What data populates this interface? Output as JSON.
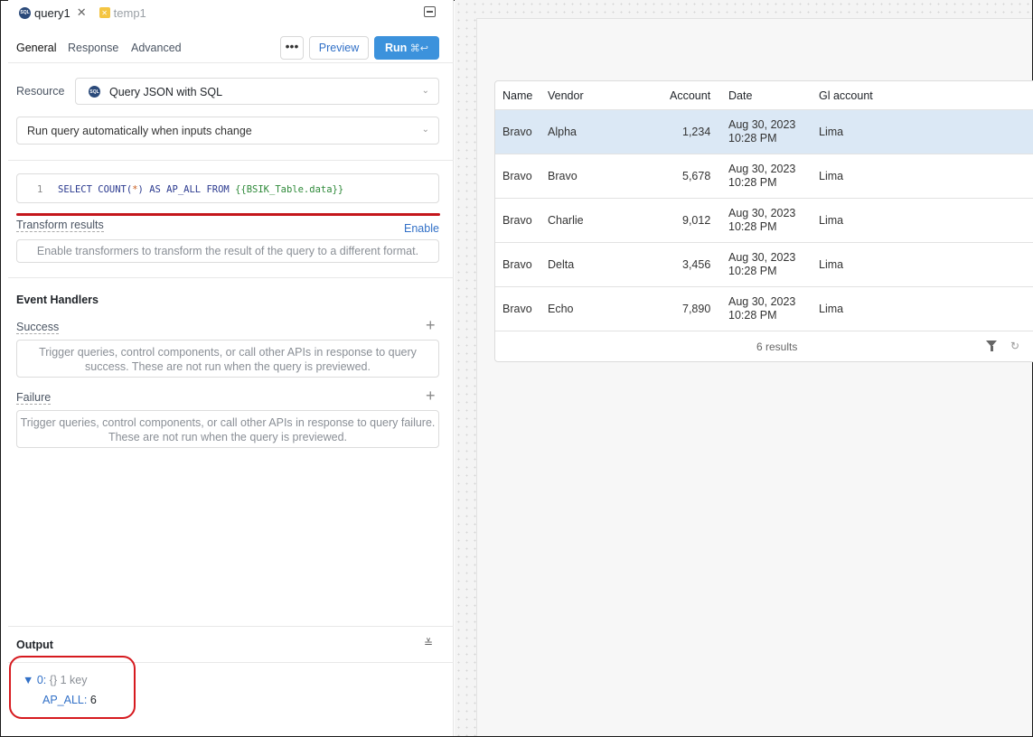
{
  "tabs": [
    {
      "label": "query1",
      "icon": "sql-icon"
    },
    {
      "label": "temp1",
      "icon": "js-icon"
    }
  ],
  "subnav": {
    "general": "General",
    "response": "Response",
    "advanced": "Advanced",
    "more": "•••",
    "preview": "Preview",
    "run": "Run",
    "run_shortcut": "⌘↩"
  },
  "resource": {
    "label": "Resource",
    "value": "Query JSON with SQL",
    "badge": "SQL"
  },
  "run_mode": "Run query automatically when inputs change",
  "editor": {
    "line": "1",
    "kw_select": "SELECT",
    "count_fn": "COUNT(",
    "star": "*",
    "count_close": ")",
    "kw_as": "AS",
    "alias": "AP_ALL",
    "kw_from": "FROM",
    "template": "{{BSIK_Table.data}}"
  },
  "transform": {
    "label": "Transform results",
    "enable": "Enable",
    "placeholder": "Enable transformers to transform the result of the query to a different format."
  },
  "events": {
    "title": "Event Handlers",
    "success_label": "Success",
    "success_help": "Trigger queries, control components, or call other APIs in response to query success. These are not run when the query is previewed.",
    "failure_label": "Failure",
    "failure_help": "Trigger queries, control components, or call other APIs in response to query failure. These are not run when the query is previewed."
  },
  "output": {
    "title": "Output",
    "index": "0:",
    "type": "{}",
    "keys": "1 key",
    "key": "AP_ALL:",
    "value": "6"
  },
  "table": {
    "columns": [
      "Name",
      "Vendor",
      "Account",
      "Date",
      "Gl account"
    ],
    "rows": [
      {
        "name": "Bravo",
        "vendor": "Alpha",
        "account": "1,234",
        "date1": "Aug 30, 2023",
        "date2": "10:28 PM",
        "gl": "Lima"
      },
      {
        "name": "Bravo",
        "vendor": "Bravo",
        "account": "5,678",
        "date1": "Aug 30, 2023",
        "date2": "10:28 PM",
        "gl": "Lima"
      },
      {
        "name": "Bravo",
        "vendor": "Charlie",
        "account": "9,012",
        "date1": "Aug 30, 2023",
        "date2": "10:28 PM",
        "gl": "Lima"
      },
      {
        "name": "Bravo",
        "vendor": "Delta",
        "account": "3,456",
        "date1": "Aug 30, 2023",
        "date2": "10:28 PM",
        "gl": "Lima"
      },
      {
        "name": "Bravo",
        "vendor": "Echo",
        "account": "7,890",
        "date1": "Aug 30, 2023",
        "date2": "10:28 PM",
        "gl": "Lima"
      }
    ],
    "footer": "6 results"
  },
  "colors": {
    "accent": "#3c92dc",
    "selected_row": "#dbe8f5",
    "annotation_red": "#d61a1f"
  }
}
